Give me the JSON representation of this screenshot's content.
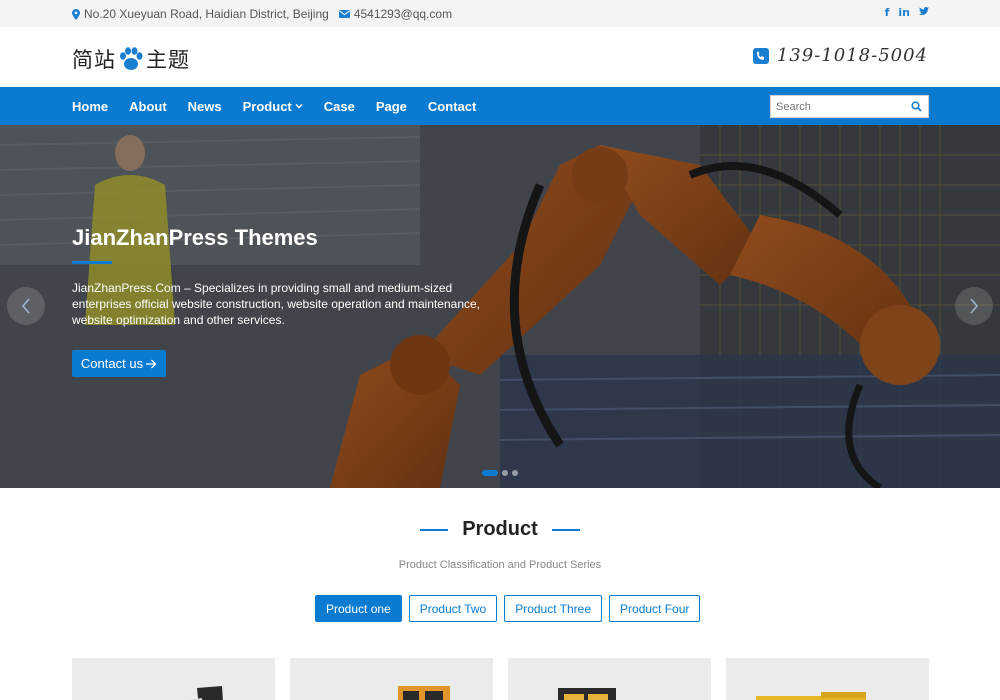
{
  "topbar": {
    "address": "No.20 Xueyuan Road, Haidian District, Beijing",
    "email": "4541293@qq.com",
    "social": [
      "f",
      "in",
      "tw"
    ]
  },
  "header": {
    "logo_left": "简站",
    "logo_right": "主题",
    "phone": "139-1018-5004"
  },
  "nav": {
    "items": [
      "Home",
      "About",
      "News",
      "Product",
      "Case",
      "Page",
      "Contact"
    ],
    "search_placeholder": "Search"
  },
  "hero": {
    "title": "JianZhanPress Themes",
    "description": "JianZhanPress.Com – Specializes in providing small and medium-sized enterprises official website construction, website operation and maintenance, website optimization and other services.",
    "button": "Contact us"
  },
  "products": {
    "title": "Product",
    "subtitle": "Product Classification and Product Series",
    "tabs": [
      "Product one",
      "Product Two",
      "Product Three",
      "Product Four"
    ]
  },
  "colors": {
    "accent": "#0b7bd1",
    "topbar_bg": "#f3f3f3"
  }
}
